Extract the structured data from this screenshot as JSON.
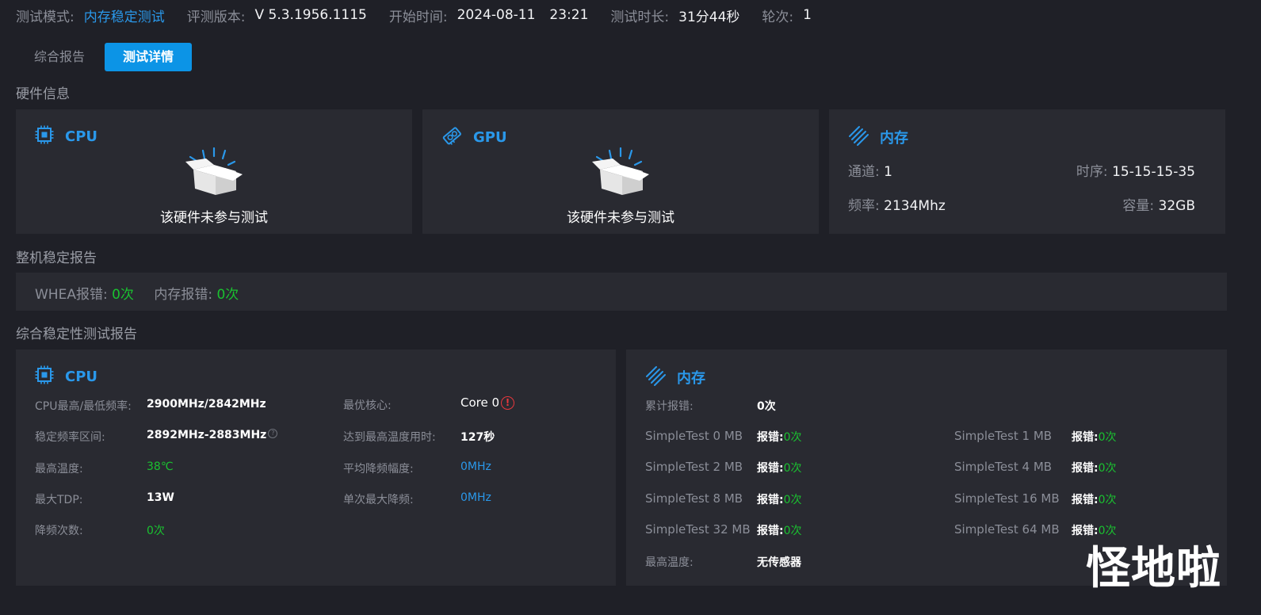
{
  "header": {
    "mode_label": "测试模式:",
    "mode_value": "内存稳定测试",
    "version_label": "评测版本:",
    "version_value": "V 5.3.1956.1115",
    "start_label": "开始时间:",
    "start_date": "2024-08-11",
    "start_time": "23:21",
    "duration_label": "测试时长:",
    "duration_value": "31分44秒",
    "round_label": "轮次:",
    "round_value": "1"
  },
  "tabs": [
    {
      "label": "综合报告"
    },
    {
      "label": "测试详情"
    }
  ],
  "hardware": {
    "section_title": "硬件信息",
    "cpu": {
      "title": "CPU",
      "status": "该硬件未参与测试"
    },
    "gpu": {
      "title": "GPU",
      "status": "该硬件未参与测试"
    },
    "memory": {
      "title": "内存",
      "channel_label": "通道:",
      "channel_value": "1",
      "timing_label": "时序:",
      "timing_value": "15-15-15-35",
      "freq_label": "频率:",
      "freq_value": "2134Mhz",
      "capacity_label": "容量:",
      "capacity_value": "32GB"
    }
  },
  "stability": {
    "section_title": "整机稳定报告",
    "whea_label": "WHEA报错:",
    "whea_value": "0次",
    "mem_label": "内存报错:",
    "mem_value": "0次"
  },
  "comprehensive": {
    "section_title": "综合稳定性测试报告",
    "cpu": {
      "title": "CPU",
      "max_min_freq_label": "CPU最高/最低频率:",
      "max_min_freq_value": "2900MHz/2842MHz",
      "stable_range_label": "稳定频率区间:",
      "stable_range_value": "2892MHz-2883MHz",
      "max_temp_label": "最高温度:",
      "max_temp_value": "38℃",
      "max_tdp_label": "最大TDP:",
      "max_tdp_value": "13W",
      "throttle_count_label": "降频次数:",
      "throttle_count_value": "0次",
      "best_core_label": "最优核心:",
      "best_core_value": "Core 0",
      "time_to_max_label": "达到最高温度用时:",
      "time_to_max_value": "127秒",
      "avg_throttle_label": "平均降频幅度:",
      "avg_throttle_value": "0MHz",
      "single_max_throttle_label": "单次最大降频:",
      "single_max_throttle_value": "0MHz"
    },
    "memory": {
      "title": "内存",
      "total_errors_label": "累计报错:",
      "total_errors_value": "0次",
      "error_word": "报错:",
      "tests": [
        {
          "name": "SimpleTest 0 MB",
          "errors": "0次"
        },
        {
          "name": "SimpleTest 1 MB",
          "errors": "0次"
        },
        {
          "name": "SimpleTest 2 MB",
          "errors": "0次"
        },
        {
          "name": "SimpleTest 4 MB",
          "errors": "0次"
        },
        {
          "name": "SimpleTest 8 MB",
          "errors": "0次"
        },
        {
          "name": "SimpleTest 16 MB",
          "errors": "0次"
        },
        {
          "name": "SimpleTest 32 MB",
          "errors": "0次"
        },
        {
          "name": "SimpleTest 64 MB",
          "errors": "0次"
        }
      ],
      "max_temp_label": "最高温度:",
      "max_temp_value": "无传感器"
    }
  },
  "watermark": "怪地啦",
  "colors": {
    "accent": "#2a98ea",
    "ok": "#1ac230",
    "warn": "#e8383d",
    "tab_active": "#0c94e6"
  }
}
